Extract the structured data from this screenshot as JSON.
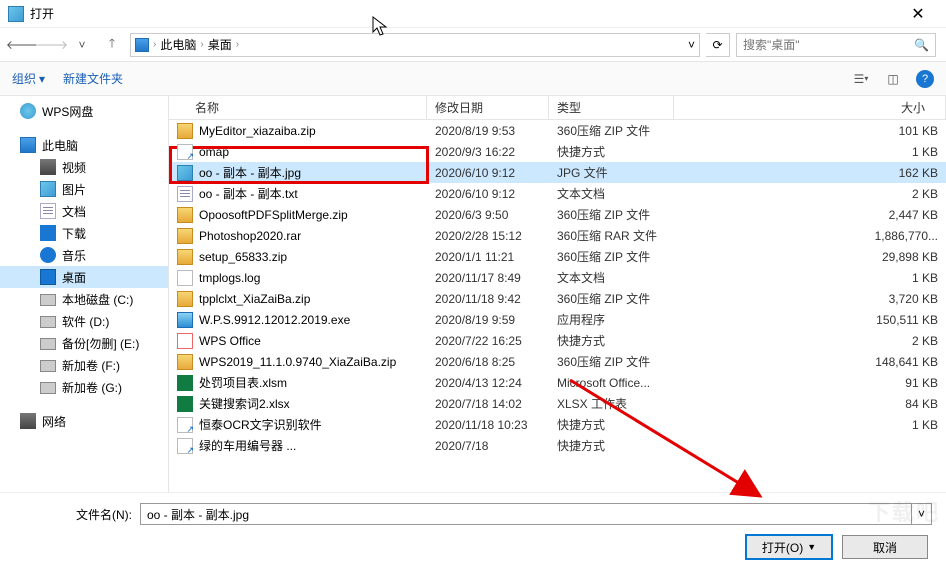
{
  "window": {
    "title": "打开"
  },
  "nav": {
    "crumbs": [
      "此电脑",
      "桌面"
    ],
    "search_placeholder": "搜索\"桌面\""
  },
  "toolbar": {
    "organize": "组织",
    "new_folder": "新建文件夹"
  },
  "sidebar": [
    {
      "label": "WPS网盘",
      "icon": "ic-cloud",
      "indent": 0
    },
    {
      "spacer": true
    },
    {
      "label": "此电脑",
      "icon": "ic-pc",
      "indent": 0
    },
    {
      "label": "视频",
      "icon": "ic-video",
      "indent": 1
    },
    {
      "label": "图片",
      "icon": "ic-img",
      "indent": 1
    },
    {
      "label": "文档",
      "icon": "ic-txt",
      "indent": 1
    },
    {
      "label": "下载",
      "icon": "ic-download",
      "indent": 1
    },
    {
      "label": "音乐",
      "icon": "ic-music",
      "indent": 1
    },
    {
      "label": "桌面",
      "icon": "ic-desktop",
      "indent": 1,
      "selected": true
    },
    {
      "label": "本地磁盘 (C:)",
      "icon": "ic-disk",
      "indent": 1
    },
    {
      "label": "软件 (D:)",
      "icon": "ic-disk",
      "indent": 1
    },
    {
      "label": "备份[勿删] (E:)",
      "icon": "ic-disk",
      "indent": 1
    },
    {
      "label": "新加卷 (F:)",
      "icon": "ic-disk",
      "indent": 1
    },
    {
      "label": "新加卷 (G:)",
      "icon": "ic-disk",
      "indent": 1
    },
    {
      "spacer": true
    },
    {
      "label": "网络",
      "icon": "ic-net",
      "indent": 0
    }
  ],
  "columns": {
    "name": "名称",
    "date": "修改日期",
    "type": "类型",
    "size": "大小"
  },
  "files": [
    {
      "name": "MyEditor_xiazaiba.zip",
      "date": "2020/8/19 9:53",
      "type": "360压缩 ZIP 文件",
      "size": "101 KB",
      "icon": "ic-zip"
    },
    {
      "name": "omap",
      "date": "2020/9/3 16:22",
      "type": "快捷方式",
      "size": "1 KB",
      "icon": "ic-link"
    },
    {
      "name": "oo - 副本 - 副本.jpg",
      "date": "2020/6/10 9:12",
      "type": "JPG 文件",
      "size": "162 KB",
      "icon": "ic-img",
      "selected": true
    },
    {
      "name": "oo - 副本 - 副本.txt",
      "date": "2020/6/10 9:12",
      "type": "文本文档",
      "size": "2 KB",
      "icon": "ic-txt"
    },
    {
      "name": "OpoosoftPDFSplitMerge.zip",
      "date": "2020/6/3 9:50",
      "type": "360压缩 ZIP 文件",
      "size": "2,447 KB",
      "icon": "ic-zip"
    },
    {
      "name": "Photoshop2020.rar",
      "date": "2020/2/28 15:12",
      "type": "360压缩 RAR 文件",
      "size": "1,886,770...",
      "icon": "ic-zip"
    },
    {
      "name": "setup_65833.zip",
      "date": "2020/1/1 11:21",
      "type": "360压缩 ZIP 文件",
      "size": "29,898 KB",
      "icon": "ic-zip"
    },
    {
      "name": "tmplogs.log",
      "date": "2020/11/17 8:49",
      "type": "文本文档",
      "size": "1 KB",
      "icon": "ic-log"
    },
    {
      "name": "tpplclxt_XiaZaiBa.zip",
      "date": "2020/11/18 9:42",
      "type": "360压缩 ZIP 文件",
      "size": "3,720 KB",
      "icon": "ic-zip"
    },
    {
      "name": "W.P.S.9912.12012.2019.exe",
      "date": "2020/8/19 9:59",
      "type": "应用程序",
      "size": "150,511 KB",
      "icon": "ic-exe"
    },
    {
      "name": "WPS Office",
      "date": "2020/7/22 16:25",
      "type": "快捷方式",
      "size": "2 KB",
      "icon": "ic-wps"
    },
    {
      "name": "WPS2019_11.1.0.9740_XiaZaiBa.zip",
      "date": "2020/6/18 8:25",
      "type": "360压缩 ZIP 文件",
      "size": "148,641 KB",
      "icon": "ic-zip"
    },
    {
      "name": "处罚项目表.xlsm",
      "date": "2020/4/13 12:24",
      "type": "Microsoft Office...",
      "size": "91 KB",
      "icon": "ic-xls"
    },
    {
      "name": "关键搜索词2.xlsx",
      "date": "2020/7/18 14:02",
      "type": "XLSX 工作表",
      "size": "84 KB",
      "icon": "ic-xls"
    },
    {
      "name": "恒泰OCR文字识别软件",
      "date": "2020/11/18 10:23",
      "type": "快捷方式",
      "size": "1 KB",
      "icon": "ic-link"
    },
    {
      "name": "绿的车用编号器 ...",
      "date": "2020/7/18",
      "type": "快捷方式",
      "size": "",
      "icon": "ic-link"
    }
  ],
  "bottom": {
    "filename_label": "文件名(N):",
    "filename_value": "oo - 副本 - 副本.jpg",
    "open": "打开(O)",
    "cancel": "取消"
  },
  "watermark": "下载吧"
}
